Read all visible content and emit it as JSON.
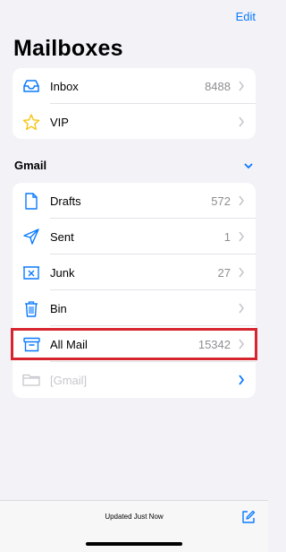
{
  "header": {
    "edit_label": "Edit",
    "title": "Mailboxes"
  },
  "mailboxes": [
    {
      "label": "Inbox",
      "count": "8488",
      "icon": "inbox-tray-icon"
    },
    {
      "label": "VIP",
      "count": "",
      "icon": "star-icon"
    }
  ],
  "section": {
    "title": "Gmail",
    "toggle_icon": "chevron-down-icon"
  },
  "gmail_folders": [
    {
      "label": "Drafts",
      "count": "572",
      "icon": "document-icon"
    },
    {
      "label": "Sent",
      "count": "1",
      "icon": "paper-plane-icon"
    },
    {
      "label": "Junk",
      "count": "27",
      "icon": "junk-tray-icon"
    },
    {
      "label": "Bin",
      "count": "",
      "icon": "trash-icon"
    },
    {
      "label": "All Mail",
      "count": "15342",
      "icon": "archive-box-icon"
    },
    {
      "label": "[Gmail]",
      "count": "",
      "icon": "folder-icon"
    }
  ],
  "footer": {
    "status": "Updated Just Now",
    "compose_icon": "compose-icon"
  },
  "colors": {
    "accent": "#0a7aff",
    "highlight": "#d6252e",
    "background": "#f2f2f7"
  }
}
